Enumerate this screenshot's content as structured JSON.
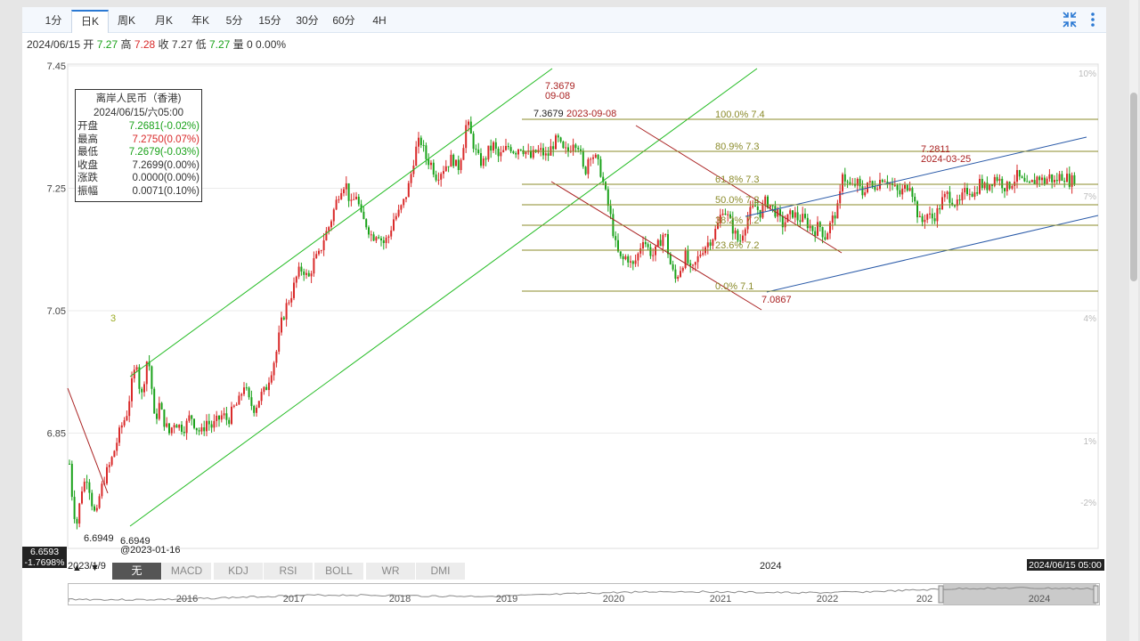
{
  "tabs": [
    "1分",
    "日K",
    "周K",
    "月K",
    "年K",
    "5分",
    "15分",
    "30分",
    "60分",
    "4H"
  ],
  "active_tab": "日K",
  "colors": {
    "up": "#d92a2a",
    "down": "#1aa21a",
    "fib": "#8b8b2a",
    "channel_green": "#22bb22",
    "channel_red": "#aa2222",
    "channel_blue": "#2a5aa8",
    "tab_active": "#2b79d3"
  },
  "icons": {
    "fullscreen": "shrink-arrows-icon",
    "more": "vertical-dots-icon"
  },
  "info_bar": {
    "date": "2024/06/15",
    "open_label": "开",
    "open": "7.27",
    "high_label": "高",
    "high": "7.28",
    "close_label": "收",
    "close": "7.27",
    "low_label": "低",
    "low": "7.27",
    "vol_label": "量",
    "vol": "0",
    "chg": "0.00%"
  },
  "tooltip": {
    "title": "离岸人民币（香港)",
    "datetime": "2024/06/15/六05:00",
    "rows": [
      {
        "label": "开盘",
        "value": "7.2681(-0.02%)",
        "tone": "down"
      },
      {
        "label": "最高",
        "value": "7.2750(0.07%)",
        "tone": "up"
      },
      {
        "label": "最低",
        "value": "7.2679(-0.03%)",
        "tone": "down"
      },
      {
        "label": "收盘",
        "value": "7.2699(0.00%)",
        "tone": "flat"
      },
      {
        "label": "涨跌",
        "value": "0.0000(0.00%)",
        "tone": "flat"
      },
      {
        "label": "振幅",
        "value": "0.0071(0.10%)",
        "tone": "flat"
      }
    ]
  },
  "chart_data": {
    "type": "candlestick",
    "title": "离岸人民币（香港)",
    "y_ticks": [
      "7.45",
      "7.25",
      "7.05",
      "6.85"
    ],
    "y_range": [
      6.65,
      7.45
    ],
    "right_ticks": [
      "10%",
      "7%",
      "4%",
      "1%",
      "-2%"
    ],
    "current_price": "6.6593",
    "current_pct": "-1.7698%",
    "x_start_label": "2023/1/9",
    "x_mid_label": "2024",
    "x_end_label": "2024/06/15 05:00",
    "count_label": "3",
    "fib_levels": [
      {
        "label": "100.0% 7.4",
        "price": 7.3679
      },
      {
        "label": "80.9% 7.3",
        "price": 7.315
      },
      {
        "label": "61.8% 7.3",
        "price": 7.262
      },
      {
        "label": "50.0% 7.2",
        "price": 7.228
      },
      {
        "label": "38.2% 7.2",
        "price": 7.196
      },
      {
        "label": "23.6% 7.2",
        "price": 7.155
      },
      {
        "label": "0.0% 7.1",
        "price": 7.0867
      }
    ],
    "annotations": [
      {
        "text": "6.6949",
        "role": "low-1"
      },
      {
        "text": "6.6949",
        "role": "low-2"
      },
      {
        "text": "@2023-01-16",
        "role": "low-2-date"
      },
      {
        "text": "7.3679",
        "role": "peak-red"
      },
      {
        "text": "09-08",
        "role": "peak-red-date"
      },
      {
        "text": "7.3679",
        "role": "peak-black"
      },
      {
        "text": "2023-09-08",
        "role": "peak-black-date"
      },
      {
        "text": "7.2811",
        "role": "march-peak"
      },
      {
        "text": "2024-03-25",
        "role": "march-peak-date"
      },
      {
        "text": "7.0867",
        "role": "trough"
      }
    ],
    "path_points": [
      [
        0,
        6.8
      ],
      [
        4,
        6.73
      ],
      [
        8,
        6.7
      ],
      [
        14,
        6.76
      ],
      [
        20,
        6.78
      ],
      [
        26,
        6.73
      ],
      [
        30,
        6.71
      ],
      [
        34,
        6.75
      ],
      [
        40,
        6.78
      ],
      [
        46,
        6.8
      ],
      [
        52,
        6.83
      ],
      [
        58,
        6.86
      ],
      [
        64,
        6.88
      ],
      [
        70,
        6.93
      ],
      [
        76,
        6.97
      ],
      [
        80,
        6.9
      ],
      [
        84,
        6.94
      ],
      [
        88,
        6.98
      ],
      [
        92,
        6.93
      ],
      [
        96,
        6.86
      ],
      [
        100,
        6.9
      ],
      [
        106,
        6.87
      ],
      [
        112,
        6.85
      ],
      [
        118,
        6.87
      ],
      [
        124,
        6.86
      ],
      [
        130,
        6.86
      ],
      [
        136,
        6.88
      ],
      [
        142,
        6.86
      ],
      [
        148,
        6.85
      ],
      [
        154,
        6.87
      ],
      [
        160,
        6.86
      ],
      [
        166,
        6.87
      ],
      [
        172,
        6.88
      ],
      [
        178,
        6.87
      ],
      [
        184,
        6.89
      ],
      [
        190,
        6.9
      ],
      [
        196,
        6.93
      ],
      [
        202,
        6.9
      ],
      [
        208,
        6.89
      ],
      [
        214,
        6.91
      ],
      [
        220,
        6.92
      ],
      [
        226,
        6.95
      ],
      [
        232,
        6.98
      ],
      [
        238,
        7.03
      ],
      [
        244,
        7.06
      ],
      [
        250,
        7.08
      ],
      [
        256,
        7.11
      ],
      [
        262,
        7.12
      ],
      [
        268,
        7.1
      ],
      [
        274,
        7.13
      ],
      [
        280,
        7.14
      ],
      [
        286,
        7.17
      ],
      [
        292,
        7.19
      ],
      [
        298,
        7.22
      ],
      [
        304,
        7.25
      ],
      [
        310,
        7.26
      ],
      [
        316,
        7.22
      ],
      [
        322,
        7.24
      ],
      [
        328,
        7.2
      ],
      [
        334,
        7.19
      ],
      [
        340,
        7.17
      ],
      [
        346,
        7.18
      ],
      [
        352,
        7.16
      ],
      [
        358,
        7.17
      ],
      [
        364,
        7.2
      ],
      [
        370,
        7.21
      ],
      [
        376,
        7.23
      ],
      [
        382,
        7.26
      ],
      [
        388,
        7.31
      ],
      [
        394,
        7.33
      ],
      [
        400,
        7.3
      ],
      [
        406,
        7.29
      ],
      [
        412,
        7.27
      ],
      [
        418,
        7.28
      ],
      [
        424,
        7.29
      ],
      [
        430,
        7.3
      ],
      [
        436,
        7.28
      ],
      [
        442,
        7.32
      ],
      [
        446,
        7.36
      ],
      [
        452,
        7.33
      ],
      [
        458,
        7.3
      ],
      [
        464,
        7.29
      ],
      [
        470,
        7.31
      ],
      [
        476,
        7.32
      ],
      [
        482,
        7.3
      ],
      [
        488,
        7.31
      ],
      [
        494,
        7.32
      ],
      [
        500,
        7.31
      ],
      [
        506,
        7.32
      ],
      [
        512,
        7.31
      ],
      [
        518,
        7.3
      ],
      [
        524,
        7.31
      ],
      [
        530,
        7.31
      ],
      [
        536,
        7.3
      ],
      [
        542,
        7.32
      ],
      [
        548,
        7.33
      ],
      [
        554,
        7.31
      ],
      [
        560,
        7.31
      ],
      [
        566,
        7.33
      ],
      [
        572,
        7.32
      ],
      [
        578,
        7.27
      ],
      [
        584,
        7.31
      ],
      [
        590,
        7.3
      ],
      [
        596,
        7.28
      ],
      [
        602,
        7.24
      ],
      [
        608,
        7.2
      ],
      [
        614,
        7.15
      ],
      [
        620,
        7.13
      ],
      [
        626,
        7.14
      ],
      [
        632,
        7.12
      ],
      [
        638,
        7.14
      ],
      [
        644,
        7.17
      ],
      [
        650,
        7.15
      ],
      [
        656,
        7.14
      ],
      [
        662,
        7.16
      ],
      [
        668,
        7.18
      ],
      [
        674,
        7.13
      ],
      [
        680,
        7.1
      ],
      [
        686,
        7.12
      ],
      [
        692,
        7.14
      ],
      [
        698,
        7.11
      ],
      [
        704,
        7.13
      ],
      [
        710,
        7.15
      ],
      [
        716,
        7.16
      ],
      [
        722,
        7.17
      ],
      [
        728,
        7.19
      ],
      [
        734,
        7.22
      ],
      [
        740,
        7.2
      ],
      [
        746,
        7.18
      ],
      [
        752,
        7.16
      ],
      [
        758,
        7.19
      ],
      [
        764,
        7.21
      ],
      [
        770,
        7.22
      ],
      [
        776,
        7.21
      ],
      [
        782,
        7.23
      ],
      [
        788,
        7.22
      ],
      [
        794,
        7.21
      ],
      [
        800,
        7.19
      ],
      [
        806,
        7.2
      ],
      [
        812,
        7.21
      ],
      [
        818,
        7.2
      ],
      [
        824,
        7.2
      ],
      [
        830,
        7.19
      ],
      [
        836,
        7.18
      ],
      [
        842,
        7.19
      ],
      [
        848,
        7.17
      ],
      [
        854,
        7.19
      ],
      [
        860,
        7.21
      ],
      [
        864,
        7.22
      ],
      [
        868,
        7.28
      ],
      [
        872,
        7.26
      ],
      [
        878,
        7.25
      ],
      [
        884,
        7.26
      ],
      [
        890,
        7.24
      ],
      [
        896,
        7.26
      ],
      [
        902,
        7.25
      ],
      [
        908,
        7.26
      ],
      [
        914,
        7.27
      ],
      [
        920,
        7.26
      ],
      [
        926,
        7.25
      ],
      [
        932,
        7.24
      ],
      [
        938,
        7.25
      ],
      [
        944,
        7.26
      ],
      [
        950,
        7.22
      ],
      [
        956,
        7.19
      ],
      [
        962,
        7.21
      ],
      [
        968,
        7.2
      ],
      [
        974,
        7.21
      ],
      [
        980,
        7.23
      ],
      [
        986,
        7.24
      ],
      [
        992,
        7.23
      ],
      [
        998,
        7.22
      ],
      [
        1004,
        7.24
      ],
      [
        1010,
        7.25
      ],
      [
        1016,
        7.24
      ],
      [
        1022,
        7.26
      ],
      [
        1028,
        7.25
      ],
      [
        1034,
        7.26
      ],
      [
        1040,
        7.27
      ],
      [
        1046,
        7.26
      ],
      [
        1052,
        7.25
      ],
      [
        1058,
        7.26
      ],
      [
        1064,
        7.27
      ],
      [
        1070,
        7.26
      ],
      [
        1076,
        7.25
      ],
      [
        1082,
        7.26
      ],
      [
        1088,
        7.27
      ],
      [
        1094,
        7.26
      ],
      [
        1100,
        7.27
      ],
      [
        1106,
        7.26
      ],
      [
        1112,
        7.27
      ],
      [
        1118,
        7.27
      ],
      [
        1124,
        7.26
      ],
      [
        1130,
        7.27
      ]
    ],
    "indicator_tabs": [
      "无",
      "MACD",
      "KDJ",
      "RSI",
      "BOLL",
      "WR",
      "DMI"
    ],
    "active_indicator": "无",
    "navigator_years": [
      "2016",
      "2017",
      "2018",
      "2019",
      "2020",
      "2021",
      "2022",
      "202",
      "2024"
    ]
  }
}
